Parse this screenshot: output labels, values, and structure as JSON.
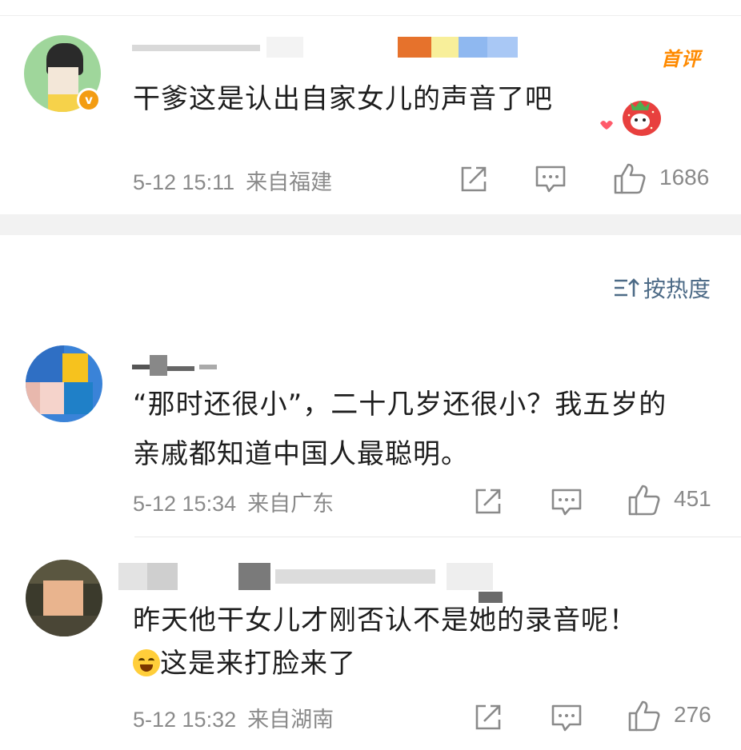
{
  "comments_top": {
    "text": "干爹这是认出自家女儿的声音了吧",
    "badge": "首评",
    "time": "5-12 15:11",
    "location": "来自福建",
    "likes": "1686",
    "verified_mark": "v"
  },
  "sort_label": "按热度",
  "comments": [
    {
      "lines": [
        "“那时还很小”，二十几岁还很小？我五岁的",
        "亲戚都知道中国人最聪明。"
      ],
      "time": "5-12 15:34",
      "location": "来自广东",
      "likes": "451"
    },
    {
      "lines": [
        "昨天他干女儿才刚否认不是她的录音呢！",
        "这是来打脸来了"
      ],
      "time": "5-12 15:32",
      "location": "来自湖南",
      "likes": "276"
    }
  ],
  "colors": {
    "meta": "#8a8a8a",
    "sort": "#4c6a86",
    "badge": "#ff8a00",
    "verified": "#f39c12"
  }
}
